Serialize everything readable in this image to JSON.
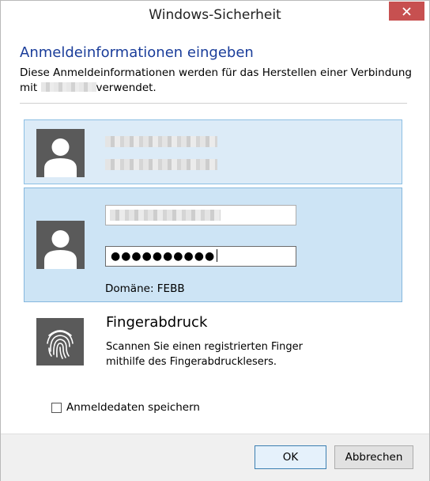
{
  "window": {
    "title": "Windows-Sicherheit"
  },
  "header": {
    "heading": "Anmeldeinformationen eingeben",
    "description_line1": "Diese Anmeldeinformationen werden für das Herstellen einer Verbindung",
    "description_line2_prefix": "mit ",
    "description_line2_suffix": "verwendet."
  },
  "accounts": {
    "selected": {
      "domain_label": "Domäne: FEBB",
      "password_value": "●●●●●●●●●●"
    }
  },
  "fingerprint": {
    "title": "Fingerabdruck",
    "line1": "Scannen Sie einen registrierten Finger",
    "line2": "mithilfe des Fingerabdrucklesers."
  },
  "remember": {
    "label": "Anmeldedaten speichern",
    "checked": false
  },
  "footer": {
    "ok_label": "OK",
    "cancel_label": "Abbrechen"
  },
  "icons": [
    "close-icon",
    "user-avatar-icon",
    "fingerprint-icon",
    "checkbox-icon"
  ],
  "colors": {
    "heading": "#1a3d9a",
    "tile_selected": "#cde4f5",
    "tile_hover": "#dcebf7",
    "close": "#c75050"
  }
}
